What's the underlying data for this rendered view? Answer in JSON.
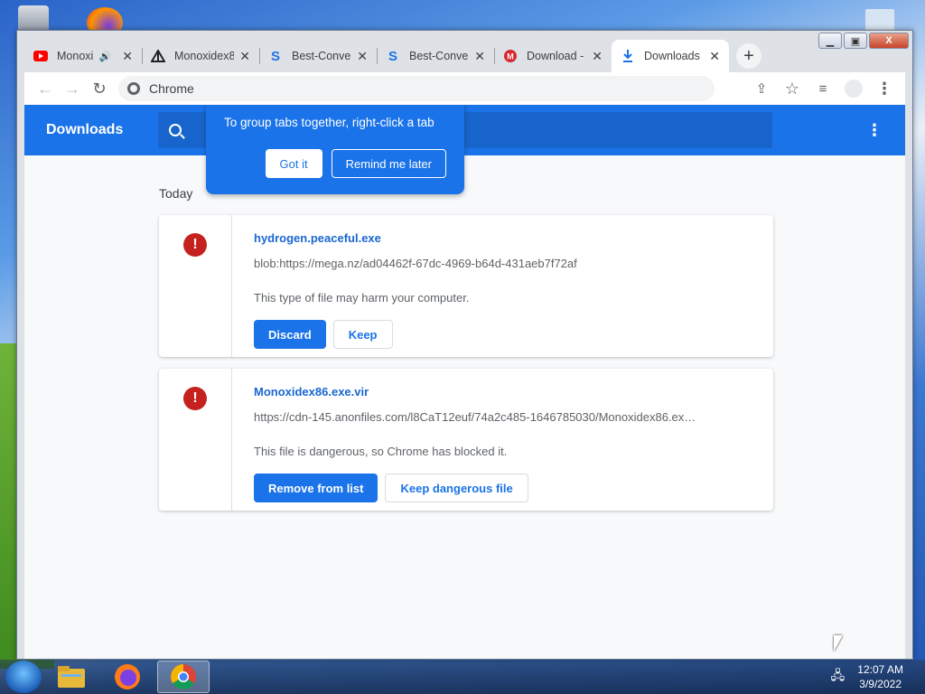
{
  "window": {
    "minimize": "▁",
    "maximize": "▣",
    "close": "X"
  },
  "tabs": [
    {
      "title": "Monoxi",
      "icon": "youtube-icon",
      "has_audio": true
    },
    {
      "title": "Monoxidex8",
      "icon": "site-icon"
    },
    {
      "title": "Best-Conve",
      "icon": "s-logo-icon"
    },
    {
      "title": "Best-Conve",
      "icon": "s-logo-icon"
    },
    {
      "title": "Download -",
      "icon": "mega-icon"
    },
    {
      "title": "Downloads",
      "icon": "download-icon",
      "active": true
    }
  ],
  "omnibox": {
    "text": "Chrome"
  },
  "header": {
    "title": "Downloads"
  },
  "promo": {
    "text": "To group tabs together, right-click a tab",
    "got_it": "Got it",
    "remind": "Remind me later"
  },
  "section_label": "Today",
  "downloads": [
    {
      "filename": "hydrogen.peaceful.exe",
      "url": "blob:https://mega.nz/ad04462f-67dc-4969-b64d-431aeb7f72af",
      "description": "This type of file may harm your computer.",
      "primary_action": "Discard",
      "secondary_action": "Keep"
    },
    {
      "filename": "Monoxidex86.exe.vir",
      "url": "https://cdn-145.anonfiles.com/l8CaT12euf/74a2c485-1646785030/Monoxidex86.ex…",
      "description": "This file is dangerous, so Chrome has blocked it.",
      "primary_action": "Remove from list",
      "secondary_action": "Keep dangerous file"
    }
  ],
  "taskbar": {
    "time": "12:07 AM",
    "date": "3/9/2022"
  },
  "colors": {
    "accent": "#1a73e8",
    "error": "#c5221f"
  }
}
